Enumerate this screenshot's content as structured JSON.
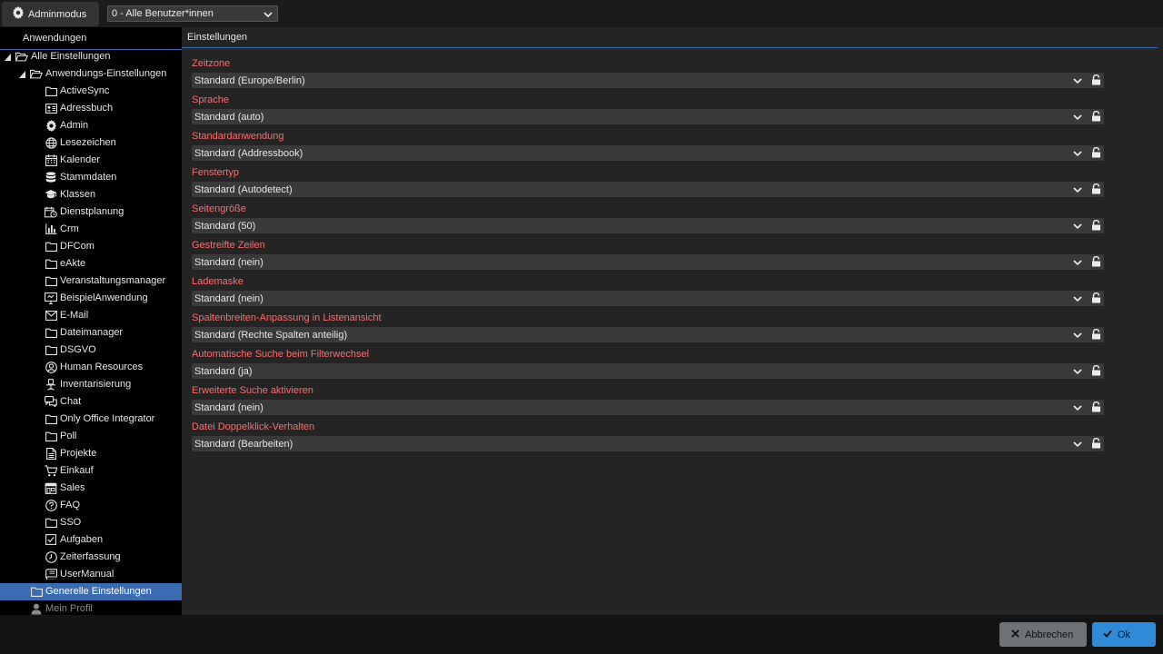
{
  "topbar": {
    "admin_label": "Adminmodus",
    "user_select_value": "0 - Alle Benutzer*innen"
  },
  "left": {
    "header": "Anwendungen",
    "tree": [
      {
        "label": "Alle Einstellungen",
        "icon": "folder-open-icon",
        "level": 0,
        "expanded": true
      },
      {
        "label": "Anwendungs-Einstellungen",
        "icon": "folder-open-icon",
        "level": 1,
        "expanded": true
      },
      {
        "label": "ActiveSync",
        "icon": "folder-icon",
        "level": 2
      },
      {
        "label": "Adressbuch",
        "icon": "address-card-icon",
        "level": 2
      },
      {
        "label": "Admin",
        "icon": "gear-icon",
        "level": 2
      },
      {
        "label": "Lesezeichen",
        "icon": "globe-icon",
        "level": 2
      },
      {
        "label": "Kalender",
        "icon": "calendar-icon",
        "level": 2
      },
      {
        "label": "Stammdaten",
        "icon": "database-icon",
        "level": 2
      },
      {
        "label": "Klassen",
        "icon": "graduation-cap-icon",
        "level": 2
      },
      {
        "label": "Dienstplanung",
        "icon": "calendar-clock-icon",
        "level": 2
      },
      {
        "label": "Crm",
        "icon": "chart-bar-icon",
        "level": 2
      },
      {
        "label": "DFCom",
        "icon": "folder-icon",
        "level": 2
      },
      {
        "label": "eAkte",
        "icon": "folder-icon",
        "level": 2
      },
      {
        "label": "Veranstaltungsmanager",
        "icon": "folder-icon",
        "level": 2
      },
      {
        "label": "BeispielAnwendung",
        "icon": "monitor-icon",
        "level": 2
      },
      {
        "label": "E-Mail",
        "icon": "envelope-icon",
        "level": 2
      },
      {
        "label": "Dateimanager",
        "icon": "folder-icon",
        "level": 2
      },
      {
        "label": "DSGVO",
        "icon": "folder-icon",
        "level": 2
      },
      {
        "label": "Human Resources",
        "icon": "user-circle-icon",
        "level": 2
      },
      {
        "label": "Inventarisierung",
        "icon": "office-chair-icon",
        "level": 2
      },
      {
        "label": "Chat",
        "icon": "chat-icon",
        "level": 2
      },
      {
        "label": "Only Office Integrator",
        "icon": "folder-icon",
        "level": 2
      },
      {
        "label": "Poll",
        "icon": "folder-icon",
        "level": 2
      },
      {
        "label": "Projekte",
        "icon": "document-icon",
        "level": 2
      },
      {
        "label": "Einkauf",
        "icon": "cart-icon",
        "level": 2
      },
      {
        "label": "Sales",
        "icon": "store-icon",
        "level": 2
      },
      {
        "label": "FAQ",
        "icon": "question-circle-icon",
        "level": 2
      },
      {
        "label": "SSO",
        "icon": "folder-icon",
        "level": 2
      },
      {
        "label": "Aufgaben",
        "icon": "checkbox-icon",
        "level": 2
      },
      {
        "label": "Zeiterfassung",
        "icon": "clock-icon",
        "level": 2
      },
      {
        "label": "UserManual",
        "icon": "book-icon",
        "level": 2
      },
      {
        "label": "Generelle Einstellungen",
        "icon": "folder-icon",
        "level": 1,
        "selected": true
      },
      {
        "label": "Mein Profil",
        "icon": "user-icon",
        "level": 1,
        "dim": true
      }
    ]
  },
  "right": {
    "header": "Einstellungen",
    "settings": [
      {
        "label": "Zeitzone",
        "value": "Standard (Europe/Berlin)"
      },
      {
        "label": "Sprache",
        "value": "Standard (auto)"
      },
      {
        "label": "Standardanwendung",
        "value": "Standard (Addressbook)"
      },
      {
        "label": "Fenstertyp",
        "value": "Standard (Autodetect)"
      },
      {
        "label": "Seitengröße",
        "value": "Standard (50)"
      },
      {
        "label": "Gestreifte Zeilen",
        "value": "Standard (nein)"
      },
      {
        "label": "Lademaske",
        "value": "Standard (nein)"
      },
      {
        "label": "Spaltenbreiten-Anpassung in Listenansicht",
        "value": "Standard (Rechte Spalten anteilig)"
      },
      {
        "label": "Automatische Suche beim Filterwechsel",
        "value": "Standard (ja)"
      },
      {
        "label": "Erweiterte Suche aktivieren",
        "value": "Standard (nein)"
      },
      {
        "label": "Datei Doppelklick-Verhalten",
        "value": "Standard (Bearbeiten)"
      }
    ]
  },
  "footer": {
    "cancel_label": "Abbrechen",
    "ok_label": "Ok"
  },
  "colors": {
    "label_red": "#ff6b6b",
    "selected_blue": "#3b6bb0",
    "ok_blue": "#2f8ad8",
    "cancel_gray": "#6e7378"
  }
}
